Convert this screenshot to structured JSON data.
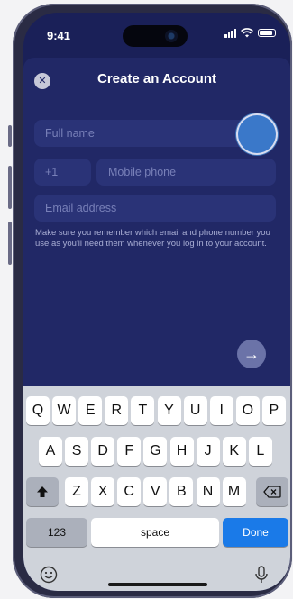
{
  "status_bar": {
    "time": "9:41"
  },
  "sheet": {
    "title": "Create an Account",
    "fields": {
      "full_name_placeholder": "Full name",
      "country_code": "+1",
      "mobile_placeholder": "Mobile phone",
      "email_placeholder": "Email address"
    },
    "hint": "Make sure you remember which email and phone number you use as you'll need them whenever you log in to your account."
  },
  "keyboard": {
    "row1": [
      "Q",
      "W",
      "E",
      "R",
      "T",
      "Y",
      "U",
      "I",
      "O",
      "P"
    ],
    "row2": [
      "A",
      "S",
      "D",
      "F",
      "G",
      "H",
      "J",
      "K",
      "L"
    ],
    "row3": [
      "Z",
      "X",
      "C",
      "V",
      "B",
      "N",
      "M"
    ],
    "numbers_label": "123",
    "space_label": "space",
    "done_label": "Done"
  },
  "colors": {
    "sheet_bg": "#212866",
    "field_bg": "#2a3377",
    "accent": "#1a7ae8"
  }
}
